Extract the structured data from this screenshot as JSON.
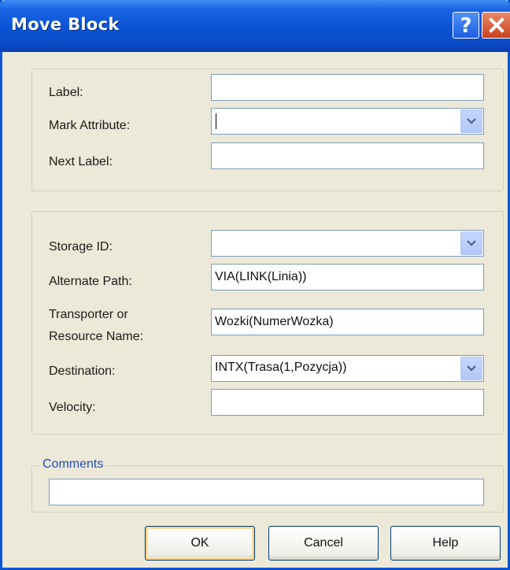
{
  "window": {
    "title": "Move Block"
  },
  "titlebar": {
    "help_icon": "question-mark",
    "close_icon": "x-close"
  },
  "section1": {
    "label_label": "Label:",
    "label_value": "",
    "mark_attribute_label": "Mark Attribute:",
    "mark_attribute_value": "",
    "next_label_label": "Next Label:",
    "next_label_value": ""
  },
  "section2": {
    "storage_id_label": "Storage ID:",
    "storage_id_value": "",
    "alternate_path_label": "Alternate Path:",
    "alternate_path_value": "VIA(LINK(Linia))",
    "transporter_label_line1": "Transporter or",
    "transporter_label_line2": "Resource Name:",
    "transporter_value": "Wozki(NumerWozka)",
    "destination_label": "Destination:",
    "destination_value": "INTX(Trasa(1,Pozycja))",
    "velocity_label": "Velocity:",
    "velocity_value": ""
  },
  "comments": {
    "legend": "Comments",
    "value": ""
  },
  "buttons": {
    "ok": "OK",
    "cancel": "Cancel",
    "help": "Help"
  },
  "colors": {
    "titlebar": "#0a53d4",
    "dialog_bg": "#ece9d8",
    "field_border": "#7f9db9",
    "legend_text": "#1f4fbd"
  }
}
